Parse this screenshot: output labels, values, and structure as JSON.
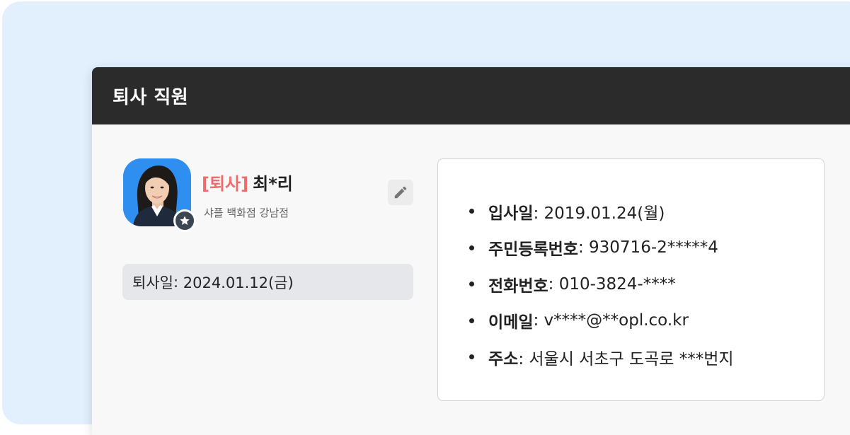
{
  "card": {
    "title": "퇴사 직원"
  },
  "profile": {
    "status_tag": "[퇴사]",
    "name": "최*리",
    "store": "샤플 백화점 강남점",
    "avatar_icon": "employee-photo",
    "badge_icon": "star-icon",
    "edit_icon": "pencil-icon"
  },
  "resignation": {
    "label": "퇴사일",
    "separator": ": ",
    "value": "2024.01.12(금)"
  },
  "details": [
    {
      "label": "입사일",
      "value": ": 2019.01.24(월)"
    },
    {
      "label": "주민등록번호",
      "value": ": 930716-2*****4"
    },
    {
      "label": "전화번호",
      "value": ": 010-3824-****"
    },
    {
      "label": "이메일",
      "value": ": v****@**opl.co.kr"
    },
    {
      "label": "주소",
      "value": ": 서울시 서초구 도곡로 ***번지"
    }
  ],
  "colors": {
    "backdrop": "#e2effd",
    "header": "#2b2b2b",
    "status_tag": "#f06b6b",
    "avatar_bg": "#2f8ff0",
    "badge_bg": "#3c4552"
  }
}
